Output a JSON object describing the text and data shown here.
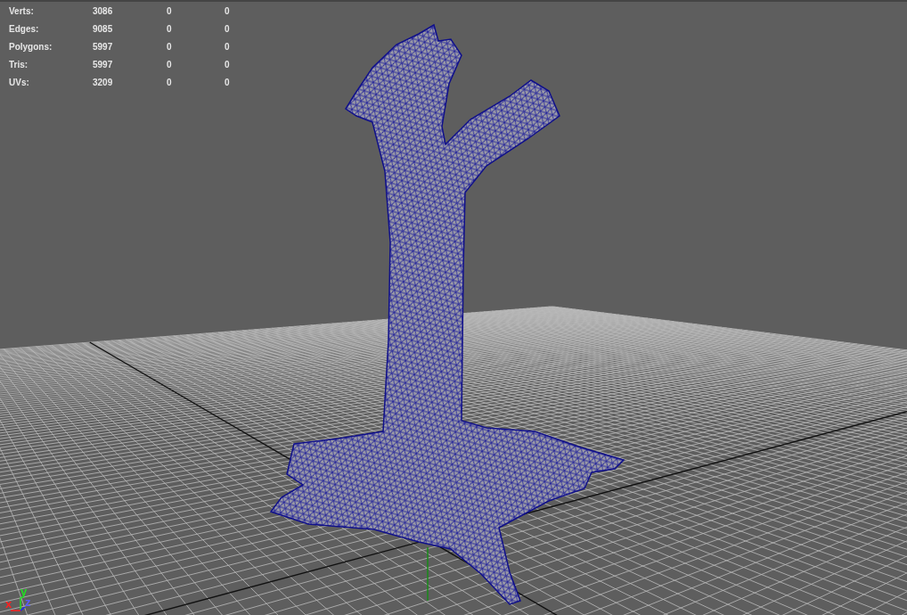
{
  "stats": [
    {
      "label": "Verts:",
      "values": [
        "3086",
        "0",
        "0"
      ]
    },
    {
      "label": "Edges:",
      "values": [
        "9085",
        "0",
        "0"
      ]
    },
    {
      "label": "Polygons:",
      "values": [
        "5997",
        "0",
        "0"
      ]
    },
    {
      "label": "Tris:",
      "values": [
        "5997",
        "0",
        "0"
      ]
    },
    {
      "label": "UVs:",
      "values": [
        "3209",
        "0",
        "0"
      ]
    }
  ],
  "axes": [
    {
      "label": "x",
      "color": "#ff2020"
    },
    {
      "label": "y",
      "color": "#20e020"
    },
    {
      "label": "z",
      "color": "#5a5aff"
    }
  ]
}
